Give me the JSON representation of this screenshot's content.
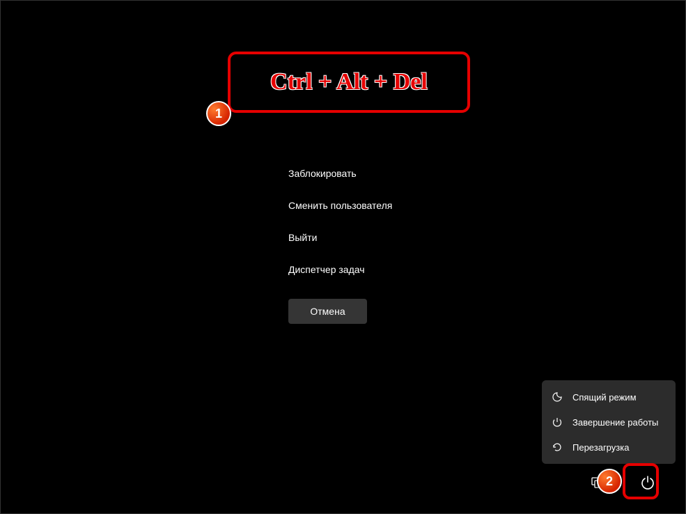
{
  "annotation": {
    "keyboard_shortcut": "Ctrl + Alt + Del",
    "badge_1": "1",
    "badge_2": "2"
  },
  "menu": {
    "items": [
      {
        "label": "Заблокировать"
      },
      {
        "label": "Сменить пользователя"
      },
      {
        "label": "Выйти"
      },
      {
        "label": "Диспетчер задач"
      }
    ],
    "cancel_label": "Отмена"
  },
  "power_menu": {
    "items": [
      {
        "label": "Спящий режим",
        "icon": "moon"
      },
      {
        "label": "Завершение работы",
        "icon": "power"
      },
      {
        "label": "Перезагрузка",
        "icon": "restart"
      }
    ]
  }
}
